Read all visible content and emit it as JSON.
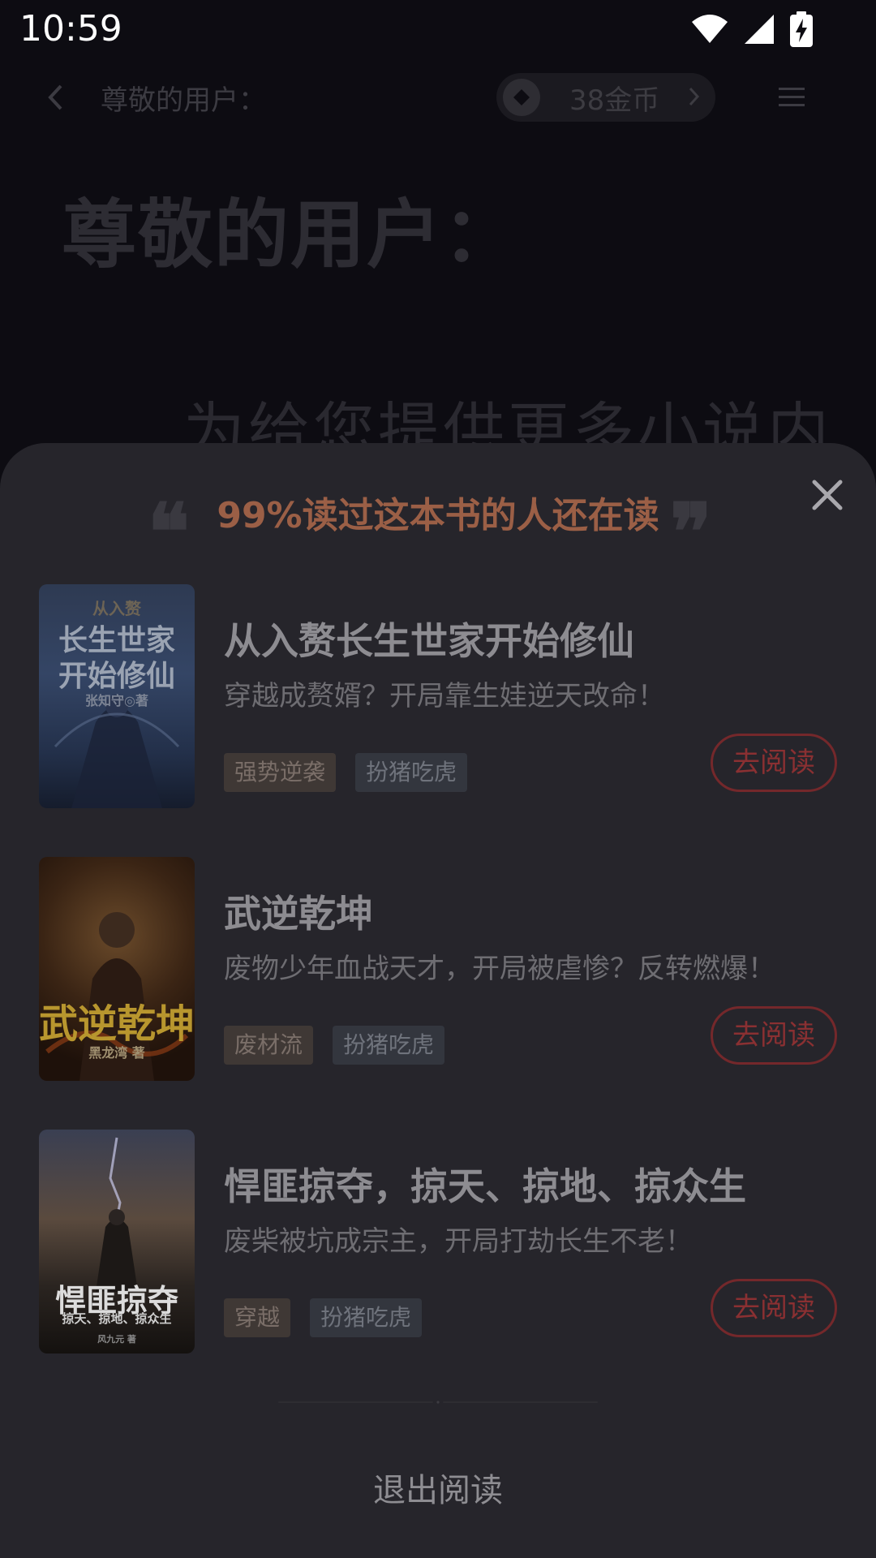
{
  "status_bar": {
    "time": "10:59"
  },
  "topbar": {
    "title": "尊敬的用户：",
    "coins": "38金币"
  },
  "background": {
    "heading": "尊敬的用户：",
    "body": "为给您提供更多小说内"
  },
  "sheet": {
    "title": "99%读过这本书的人还在读",
    "quote_open": "❝",
    "quote_close": "❞",
    "books": [
      {
        "title": "从入赘长生世家开始修仙",
        "desc": "穿越成赘婿？开局靠生娃逆天改命！",
        "tags": [
          "强势逆袭",
          "扮猪吃虎"
        ],
        "button": "去阅读",
        "cover_lines": [
          "从入赘",
          "长生世家",
          "开始修仙"
        ],
        "cover_author": "张知守◎著"
      },
      {
        "title": "武逆乾坤",
        "desc": "废物少年血战天才，开局被虐惨？反转燃爆！",
        "tags": [
          "废材流",
          "扮猪吃虎"
        ],
        "button": "去阅读",
        "cover_lines": [
          "武逆乾坤"
        ],
        "cover_author": "黑龙湾 著"
      },
      {
        "title": "悍匪掠夺，掠天、掠地、掠众生",
        "desc": "废柴被坑成宗主，开局打劫长生不老！",
        "tags": [
          "穿越",
          "扮猪吃虎"
        ],
        "button": "去阅读",
        "cover_lines": [
          "悍匪掠夺",
          "掠天、掠地、掠众生"
        ],
        "cover_author": "风九元 著"
      }
    ],
    "exit": "退出阅读"
  },
  "colors": {
    "accent_title": "#9b5f46",
    "read_button": "#8a3032",
    "sheet_bg": "#26252b"
  }
}
